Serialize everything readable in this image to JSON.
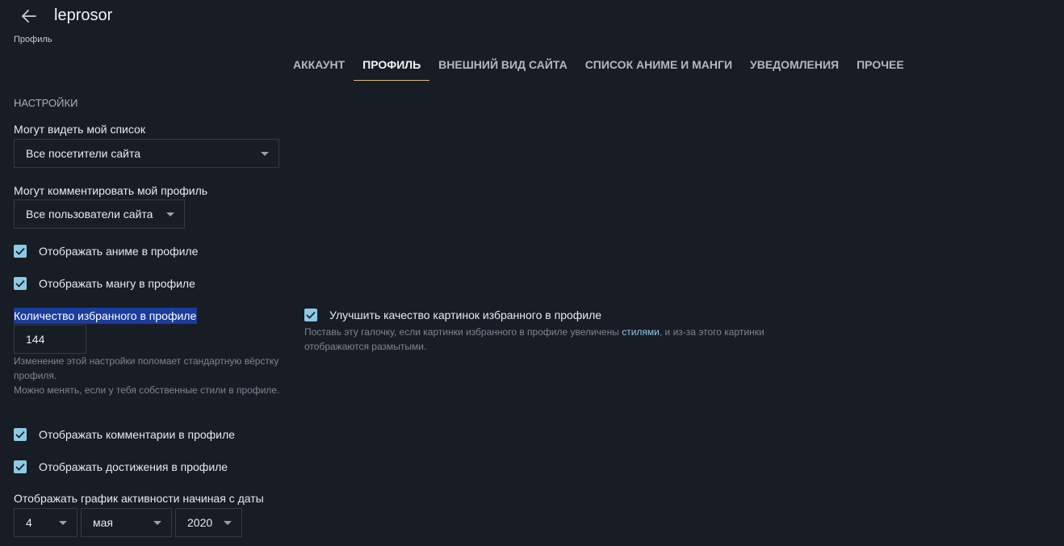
{
  "header": {
    "username": "leprosor",
    "breadcrumb": "Профиль"
  },
  "tabs": [
    {
      "label": "АККАУНТ",
      "active": false
    },
    {
      "label": "ПРОФИЛЬ",
      "active": true
    },
    {
      "label": "ВНЕШНИЙ ВИД САЙТА",
      "active": false
    },
    {
      "label": "СПИСОК АНИМЕ И МАНГИ",
      "active": false
    },
    {
      "label": "УВЕДОМЛЕНИЯ",
      "active": false
    },
    {
      "label": "ПРОЧЕЕ",
      "active": false
    }
  ],
  "settings": {
    "title": "НАСТРОЙКИ",
    "list_visibility": {
      "label": "Могут видеть мой список",
      "value": "Все посетители сайта"
    },
    "profile_comments": {
      "label": "Могут комментировать мой профиль",
      "value": "Все пользователи сайта"
    },
    "show_anime": {
      "label": "Отображать аниме в профиле",
      "checked": true
    },
    "show_manga": {
      "label": "Отображать мангу в профиле",
      "checked": true
    },
    "favorites_count": {
      "label": "Количество избранного в профиле",
      "value": "144",
      "hint_line1": "Изменение этой настройки поломает стандартную вёрстку",
      "hint_line2": "профиля.",
      "hint_line3": "Можно менять, если у тебя собственные стили в профиле."
    },
    "improve_quality": {
      "label": "Улучшить качество картинок избранного в профиле",
      "checked": true,
      "hint_before": "Поставь эту галочку, если картинки избранного в профиле увеличены ",
      "hint_link": "стилями",
      "hint_after": ", и из-за этого картинки",
      "hint_line2": "отображаются размытыми."
    },
    "show_comments": {
      "label": "Отображать комментарии в профиле",
      "checked": true
    },
    "show_achievements": {
      "label": "Отображать достижения в профиле",
      "checked": true
    },
    "activity_start": {
      "label": "Отображать график активности начиная с даты",
      "day": "4",
      "month": "мая",
      "year": "2020"
    }
  },
  "colors": {
    "background": "#181c24",
    "accent": "#8ecae6",
    "tab_underline": "#d9c27a",
    "selection": "#1a3c9b"
  },
  "icons": {
    "back": "arrow-left-icon",
    "dropdown": "caret-down-icon",
    "checkbox": "checkmark-icon"
  }
}
